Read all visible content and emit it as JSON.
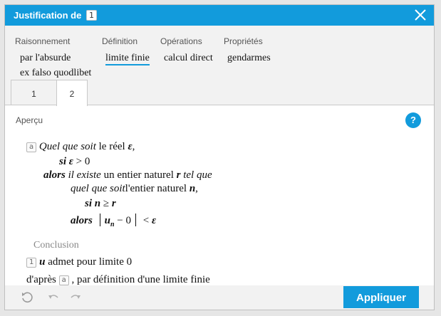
{
  "dialog": {
    "title": "Justification de",
    "title_ref": "1"
  },
  "categories": [
    {
      "label": "Raisonnement",
      "items": [
        "par l'absurde",
        "ex falso quodlibet"
      ]
    },
    {
      "label": "Définition",
      "items": [
        "limite finie"
      ]
    },
    {
      "label": "Opérations",
      "items": [
        "calcul direct"
      ]
    },
    {
      "label": "Propriétés",
      "items": [
        "gendarmes"
      ]
    }
  ],
  "selected_item": "limite finie",
  "tabs": [
    "1",
    "2"
  ],
  "active_tab": "2",
  "preview": {
    "label": "Aperçu",
    "help": "?",
    "hyp_ref": "a",
    "line1": {
      "quel": "Quel que soit",
      "text": "le réel",
      "var": "ε",
      "comma": ","
    },
    "line2": {
      "si": "si",
      "var": "ε",
      "rel": "> 0"
    },
    "line3": {
      "alors": "alors",
      "il_existe": "il existe",
      "text": "un entier naturel",
      "var": "r",
      "tel_que": "tel que"
    },
    "line4": {
      "quel": "quel que soit",
      "text": "l'entier naturel",
      "var": "n",
      "comma": ","
    },
    "line5": {
      "si": "si",
      "var": "n",
      "rel": "≥",
      "var2": "r"
    },
    "line6": {
      "alors": "alors",
      "u": "u",
      "sub": "n",
      "minus": "− 0",
      "lt": "<",
      "eps": "ε"
    },
    "conclusion_label": "Conclusion",
    "concl_ref": "1",
    "concl": {
      "u": "u",
      "text": "admet pour limite 0"
    },
    "dapres": {
      "before": "d'après",
      "ref": "a",
      "after": ", par définition d'une limite finie"
    }
  },
  "footer": {
    "apply_label": "Appliquer"
  },
  "colors": {
    "accent": "#129bdc"
  }
}
